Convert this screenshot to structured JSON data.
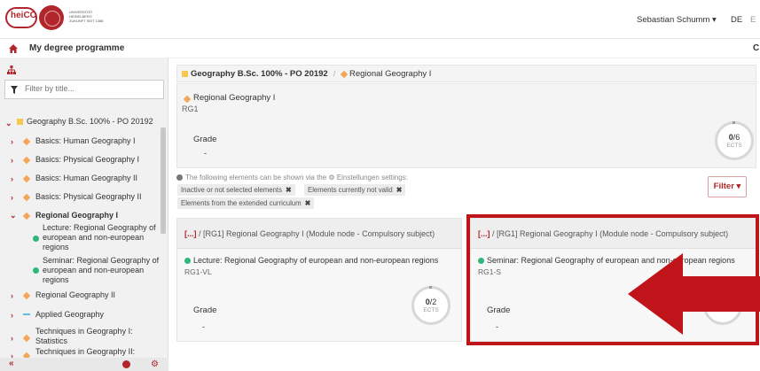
{
  "header": {
    "logo_text": "heiCO",
    "uni_text": "UNIVERSITÄT HEIDELBERG ZUKUNFT SEIT 1386",
    "user": "Sebastian Schumm ▾",
    "lang_de": "DE",
    "lang_en": "E"
  },
  "subheader": {
    "title": "My degree programme",
    "right": "C"
  },
  "sidebar": {
    "filter_placeholder": "Filter by title...",
    "items": [
      {
        "label": "Geography B.Sc. 100% - PO 20192",
        "kind": "programme"
      },
      {
        "label": "Basics: Human Geography I",
        "kind": "module"
      },
      {
        "label": "Basics: Physical Geography I",
        "kind": "module"
      },
      {
        "label": "Basics: Human Geography II",
        "kind": "module"
      },
      {
        "label": "Basics: Physical Geography II",
        "kind": "module"
      },
      {
        "label": "Regional Geography I",
        "kind": "module-open"
      },
      {
        "label": "Lecture: Regional Geography of european and non-european regions",
        "kind": "element"
      },
      {
        "label": "Seminar: Regional Geography of european and non-european regions",
        "kind": "element"
      },
      {
        "label": "Regional Geography II",
        "kind": "module"
      },
      {
        "label": "Applied Geography",
        "kind": "group"
      },
      {
        "label": "Techniques in Geography I: Statistics",
        "kind": "module"
      },
      {
        "label": "Techniques in Geography II:",
        "kind": "module"
      }
    ],
    "collapse": "«"
  },
  "breadcrumb": {
    "programme": "Geography B.Sc. 100% - PO 20192",
    "sep": "/",
    "node": "Regional Geography I"
  },
  "module": {
    "title": "Regional Geography I",
    "code": "RG1",
    "grade_label": "Grade",
    "grade_value": "-",
    "ects_earned": "0",
    "ects_total": "/6",
    "ects_unit": "ECTS"
  },
  "info": {
    "text": "The following elements can be shown via the ⚙ Einstellungen settings:",
    "chips": [
      "Inactive or not selected elements",
      "Elements currently not valid",
      "Elements from the extended curriculum"
    ],
    "chip_x": "✖",
    "filter_button": "Filter ▾"
  },
  "cards": [
    {
      "path_prefix": "[...]",
      "path": " / [RG1] Regional Geography I (Module node - Compulsory subject)",
      "title": "Lecture: Regional Geography of european and non-european regions",
      "code": "RG1-VL",
      "grade_label": "Grade",
      "grade_value": "-",
      "ects_earned": "0",
      "ects_total": "/2",
      "ects_unit": "ECTS"
    },
    {
      "path_prefix": "[...]",
      "path": " / [RG1] Regional Geography I (Module node - Compulsory subject)",
      "title": "Seminar: Regional Geography of european and non-european regions",
      "code": "RG1-S",
      "grade_label": "Grade",
      "grade_value": "-",
      "ects_earned": "0",
      "ects_total": "/4",
      "ects_unit": "ECTS"
    }
  ],
  "colors": {
    "brand": "#b0262b",
    "highlight": "#c0141b",
    "module": "#f2a65a",
    "programme": "#f5c94f",
    "element": "#2fb67a"
  }
}
